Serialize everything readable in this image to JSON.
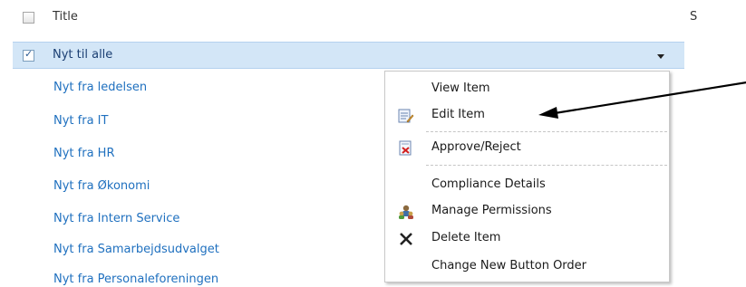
{
  "header": {
    "title_label": "Title",
    "s_label": "S"
  },
  "selected_item": {
    "title": "Nyt til alle",
    "checked": true
  },
  "items": [
    "Nyt fra ledelsen",
    "Nyt fra IT",
    "Nyt fra HR",
    "Nyt fra Økonomi",
    "Nyt fra Intern Service",
    "Nyt fra Samarbejdsudvalget",
    "Nyt fra Personaleforeningen"
  ],
  "context_menu": {
    "items": [
      {
        "label": "View Item",
        "icon": "none"
      },
      {
        "label": "Edit Item",
        "icon": "edit-icon"
      },
      {
        "label": "Approve/Reject",
        "icon": "approve-reject-icon"
      },
      {
        "label": "Compliance Details",
        "icon": "none"
      },
      {
        "label": "Manage Permissions",
        "icon": "permissions-icon"
      },
      {
        "label": "Delete Item",
        "icon": "delete-icon"
      },
      {
        "label": "Change New Button Order",
        "icon": "none"
      }
    ]
  },
  "colors": {
    "link": "#1f70bf",
    "selected_row_bg": "#d3e6f7",
    "menu_border": "#c8c8c8"
  }
}
